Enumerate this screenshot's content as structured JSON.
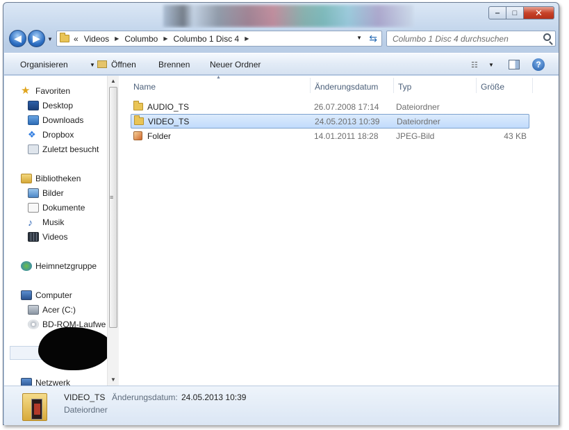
{
  "window": {
    "minimize": "‒",
    "maximize": "□",
    "close": "✕"
  },
  "address": {
    "overflow": "«",
    "crumbs": [
      "Videos",
      "Columbo",
      "Columbo 1 Disc 4"
    ]
  },
  "search": {
    "placeholder": "Columbo 1 Disc 4 durchsuchen"
  },
  "toolbar": {
    "organize_label": "Organisieren",
    "open_label": "Öffnen",
    "burn_label": "Brennen",
    "new_folder_label": "Neuer Ordner",
    "help_label": "?"
  },
  "nav": {
    "favorites": {
      "label": "Favoriten",
      "items": [
        "Desktop",
        "Downloads",
        "Dropbox",
        "Zuletzt besucht"
      ]
    },
    "libraries": {
      "label": "Bibliotheken",
      "items": [
        "Bilder",
        "Dokumente",
        "Musik",
        "Videos"
      ]
    },
    "homegroup": "Heimnetzgruppe",
    "computer": {
      "label": "Computer",
      "items": [
        "Acer (C:)",
        "BD-ROM-Laufwe"
      ]
    },
    "network": "Netzwerk"
  },
  "columns": {
    "name": "Name",
    "date": "Änderungsdatum",
    "type": "Typ",
    "size": "Größe"
  },
  "files": [
    {
      "name": "AUDIO_TS",
      "date": "26.07.2008 17:14",
      "type": "Dateiordner",
      "size": "",
      "icon": "folder-icon",
      "selected": false
    },
    {
      "name": "VIDEO_TS",
      "date": "24.05.2013 10:39",
      "type": "Dateiordner",
      "size": "",
      "icon": "folder-icon",
      "selected": true
    },
    {
      "name": "Folder",
      "date": "14.01.2011 18:28",
      "type": "JPEG-Bild",
      "size": "43 KB",
      "icon": "jpeg-image-icon",
      "selected": false
    }
  ],
  "details": {
    "name": "VIDEO_TS",
    "date_label": "Änderungsdatum:",
    "date_value": "24.05.2013 10:39",
    "type": "Dateiordner"
  },
  "colors": {
    "selection": "#c1dbfc",
    "selection_border": "#7da2ce",
    "toolbar": "#e2ebf6"
  }
}
